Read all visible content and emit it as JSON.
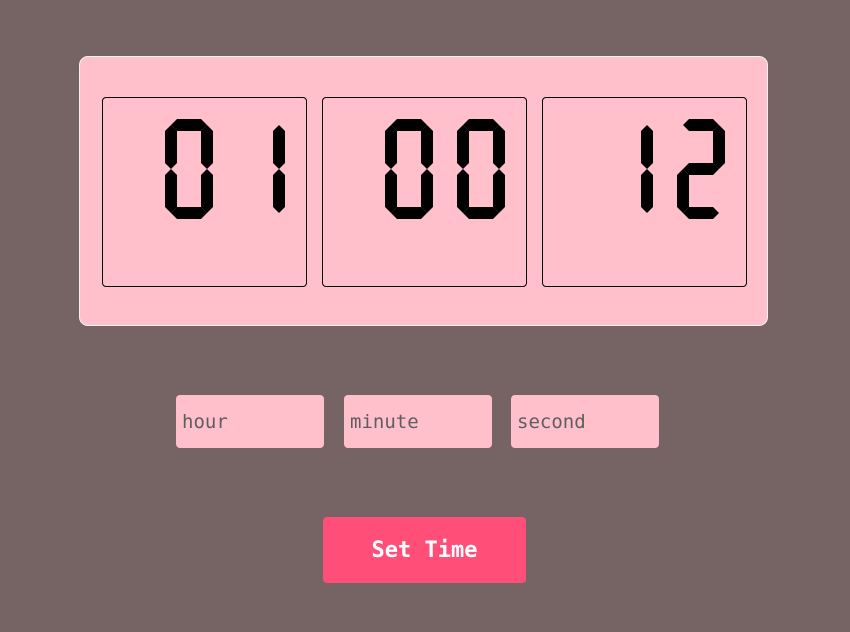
{
  "clock": {
    "hours": "01",
    "minutes": "00",
    "seconds": "12"
  },
  "inputs": {
    "hour_placeholder": "hour",
    "minute_placeholder": "minute",
    "second_placeholder": "second"
  },
  "actions": {
    "set_time_label": "Set Time"
  },
  "colors": {
    "background": "#766364",
    "panel": "#ffc0cb",
    "digit": "#000000",
    "button": "#ff4f79",
    "button_text": "#ffffff"
  }
}
